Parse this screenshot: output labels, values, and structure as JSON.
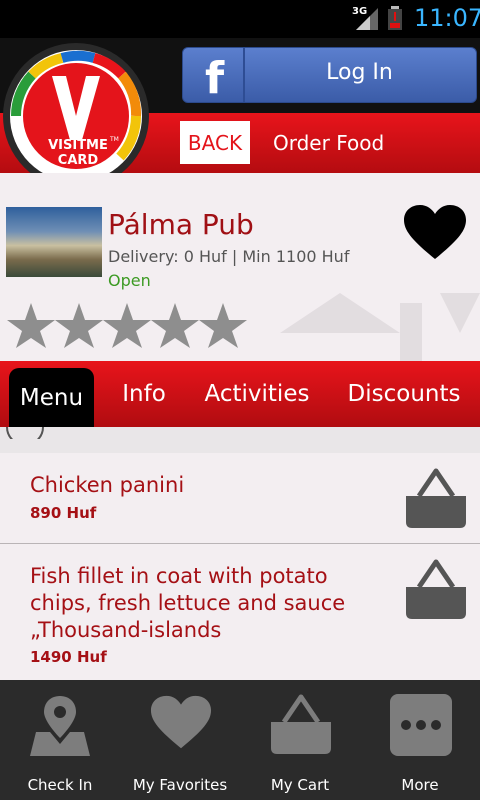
{
  "status": {
    "network": "3G",
    "time": "11:07"
  },
  "header": {
    "login_label": "Log In",
    "back_label": "BACK",
    "title": "Order Food",
    "logo_text": [
      "VISITME",
      "CARD"
    ],
    "logo_tm": "TM"
  },
  "restaurant": {
    "name": "Pálma Pub",
    "delivery": "Delivery: 0 Huf | Min 1100 Huf",
    "status": "Open",
    "rating": 0,
    "rating_max": 5
  },
  "tabs": [
    {
      "label": "Menu",
      "active": true
    },
    {
      "label": "Info"
    },
    {
      "label": "Activities"
    },
    {
      "label": "Discounts"
    }
  ],
  "menu_items": [
    {
      "name": "Chicken panini",
      "price": "890 Huf"
    },
    {
      "name": [
        "Fish fillet in coat with potato",
        "chips, fresh lettuce and sauce",
        "„Thousand-islands"
      ],
      "price": "1490 Huf"
    }
  ],
  "bottom_nav": [
    {
      "label": "Check In",
      "icon": "map-pin-icon"
    },
    {
      "label": "My Favorites",
      "icon": "heart-icon"
    },
    {
      "label": "My Cart",
      "icon": "basket-icon"
    },
    {
      "label": "More",
      "icon": "more-icon"
    }
  ],
  "colors": {
    "brand_red": "#e4141b",
    "text_red": "#a51015",
    "open_green": "#3c9a23",
    "facebook_blue": "#3b5ca8",
    "status_time": "#3ab6ff"
  }
}
